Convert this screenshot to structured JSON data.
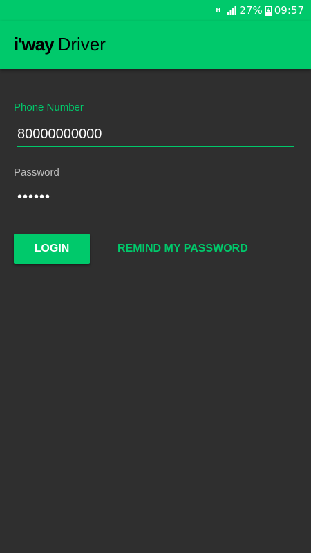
{
  "status_bar": {
    "network_type": "H+",
    "battery_percent": "27%",
    "time": "09:57",
    "icons": [
      "signal-icon",
      "battery-charging-icon"
    ]
  },
  "app_bar": {
    "brand": "i'way",
    "title": "Driver"
  },
  "form": {
    "phone": {
      "label": "Phone Number",
      "value": "80000000000"
    },
    "password": {
      "label": "Password",
      "value": "••••••"
    }
  },
  "actions": {
    "login_label": "LOGIN",
    "remind_label": "REMIND MY PASSWORD"
  },
  "colors": {
    "accent": "#00c96b",
    "background": "#2f2f2f",
    "text": "#ffffff",
    "muted": "#bdbdbd"
  }
}
